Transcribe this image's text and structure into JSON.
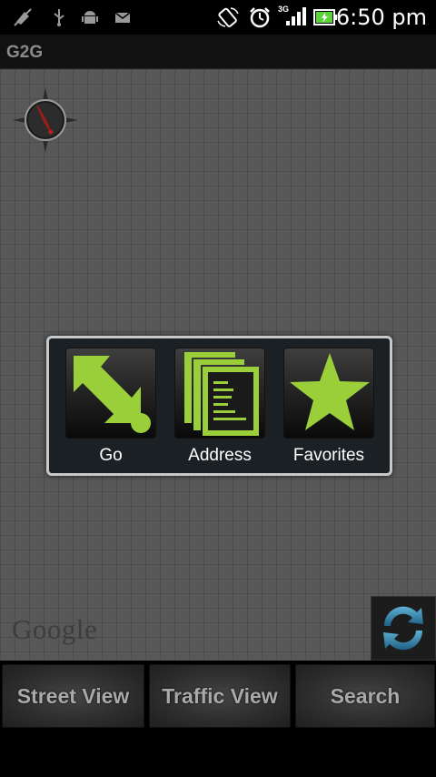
{
  "status_bar": {
    "time": "6:50 pm",
    "network": "3G",
    "icons": [
      "signal-off-icon",
      "usb-icon",
      "android-icon",
      "mail-icon",
      "rotate-icon",
      "alarm-icon",
      "network-signal-icon",
      "battery-charging-icon"
    ]
  },
  "app": {
    "title": "G2G"
  },
  "map": {
    "logo": "Google",
    "controls": [
      "compass-icon",
      "refresh-icon"
    ]
  },
  "dialog": {
    "buttons": [
      {
        "label": "Go",
        "icon": "go-arrow-icon"
      },
      {
        "label": "Address",
        "icon": "address-document-icon"
      },
      {
        "label": "Favorites",
        "icon": "star-icon"
      }
    ]
  },
  "bottom_bar": {
    "buttons": [
      {
        "label": "Street View"
      },
      {
        "label": "Traffic View"
      },
      {
        "label": "Search"
      }
    ]
  },
  "colors": {
    "accent_green": "#9bcf3a",
    "map_bg": "#585858",
    "dialog_bg": "#1b2024"
  }
}
